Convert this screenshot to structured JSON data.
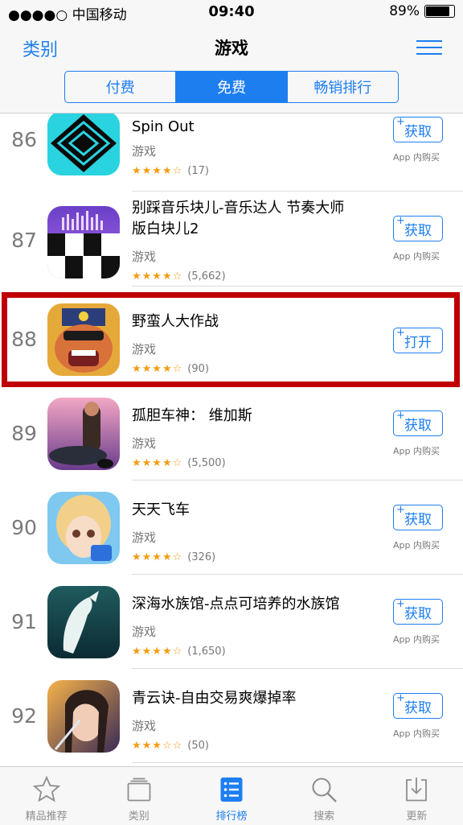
{
  "status_bar": {
    "carrier": "●●●●○ 中国移动",
    "time": "09:40",
    "battery": "89%"
  },
  "nav": {
    "back_label": "类别",
    "title": "游戏"
  },
  "segments": [
    {
      "label": "付费",
      "active": false
    },
    {
      "label": "免费",
      "active": true
    },
    {
      "label": "畅销排行",
      "active": false
    }
  ],
  "apps": [
    {
      "rank": "86",
      "title": "Spin Out",
      "category": "游戏",
      "stars": "★★★★☆",
      "rating_count": "(17)",
      "button": "获取",
      "iap": "App 内购买",
      "icon": "spin-out-icon"
    },
    {
      "rank": "87",
      "title": "别踩音乐块儿-音乐达人 节奏大师版白块儿2",
      "category": "游戏",
      "stars": "★★★★☆",
      "rating_count": "(5,662)",
      "button": "获取",
      "iap": "App 内购买",
      "icon": "piano-tiles-icon"
    },
    {
      "rank": "88",
      "title": "野蛮人大作战",
      "category": "游戏",
      "stars": "★★★★☆",
      "rating_count": "(90)",
      "button": "打开",
      "iap": "",
      "icon": "barbarian-icon"
    },
    {
      "rank": "89",
      "title": "孤胆车神： 维加斯",
      "category": "游戏",
      "stars": "★★★★☆",
      "rating_count": "(5,500)",
      "button": "获取",
      "iap": "App 内购买",
      "icon": "gangstar-icon"
    },
    {
      "rank": "90",
      "title": "天天飞车",
      "category": "游戏",
      "stars": "★★★★☆",
      "rating_count": "(326)",
      "button": "获取",
      "iap": "App 内购买",
      "icon": "racing-girl-icon"
    },
    {
      "rank": "91",
      "title": "深海水族馆-点点可培养的水族馆",
      "category": "游戏",
      "stars": "★★★★☆",
      "rating_count": "(1,650)",
      "button": "获取",
      "iap": "App 内购买",
      "icon": "whale-icon"
    },
    {
      "rank": "92",
      "title": "青云诀-自由交易爽爆掉率",
      "category": "游戏",
      "stars": "★★★☆☆",
      "rating_count": "(50)",
      "button": "获取",
      "iap": "App 内购买",
      "icon": "warrior-woman-icon"
    }
  ],
  "tabs": [
    {
      "label": "精品推荐",
      "icon": "star-icon",
      "active": false
    },
    {
      "label": "类别",
      "icon": "categories-icon",
      "active": false
    },
    {
      "label": "排行榜",
      "icon": "top-charts-icon",
      "active": true
    },
    {
      "label": "搜索",
      "icon": "search-icon",
      "active": false
    },
    {
      "label": "更新",
      "icon": "updates-icon",
      "active": false
    }
  ],
  "colors": {
    "accent": "#1d7ef0",
    "highlight": "#c00000",
    "stars": "#f39c12"
  }
}
